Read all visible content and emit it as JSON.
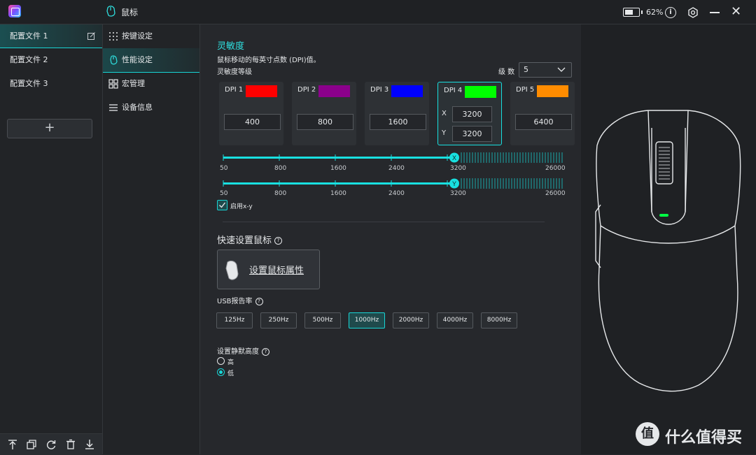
{
  "titlebar": {
    "section_title": "鼠标",
    "battery_percent": "62%"
  },
  "profiles": {
    "items": [
      {
        "label": "配置文件 1",
        "active": true
      },
      {
        "label": "配置文件 2",
        "active": false
      },
      {
        "label": "配置文件 3",
        "active": false
      }
    ],
    "add_label": "+"
  },
  "nav": {
    "items": [
      {
        "label": "按键设定",
        "icon": "grid-dots-icon",
        "active": false
      },
      {
        "label": "性能设定",
        "icon": "gauge-icon",
        "active": true
      },
      {
        "label": "宏管理",
        "icon": "macro-icon",
        "active": false
      },
      {
        "label": "设备信息",
        "icon": "list-icon",
        "active": false
      }
    ]
  },
  "sensitivity": {
    "title": "灵敏度",
    "description": "鼠标移动的每英寸点数 (DPI)值。",
    "levels_label": "灵敏度等级",
    "level_count_label": "级 数",
    "level_count_value": "5",
    "cards": [
      {
        "label": "DPI 1",
        "color": "#ff0000",
        "value": "400"
      },
      {
        "label": "DPI 2",
        "color": "#8b008b",
        "value": "800"
      },
      {
        "label": "DPI 3",
        "color": "#0000ff",
        "value": "1600"
      },
      {
        "label": "DPI 4",
        "color": "#00ff00",
        "x_label": "X",
        "x_value": "3200",
        "y_label": "Y",
        "y_value": "3200",
        "active": true
      },
      {
        "label": "DPI 5",
        "color": "#ff8c00",
        "value": "6400"
      }
    ],
    "slider_ticks": [
      "50",
      "800",
      "1600",
      "2400",
      "3200",
      "26000"
    ],
    "slider_x": {
      "handle_label": "X",
      "value": "3200"
    },
    "slider_y": {
      "handle_label": "Y",
      "value": "3200"
    },
    "enable_xy_label": "启用x-y",
    "enable_xy_checked": true
  },
  "quick_setup": {
    "title": "快速设置鼠标",
    "button_label": "设置鼠标属性"
  },
  "polling": {
    "title": "USB报告率",
    "rates": [
      "125Hz",
      "250Hz",
      "500Hz",
      "1000Hz",
      "2000Hz",
      "4000Hz",
      "8000Hz"
    ],
    "selected": "1000Hz"
  },
  "lod": {
    "title": "设置静默高度",
    "options": [
      {
        "label": "高",
        "selected": false
      },
      {
        "label": "低",
        "selected": true
      }
    ]
  },
  "watermark": {
    "text": "什么值得买"
  },
  "colors": {
    "accent": "#18d6d6",
    "background": "#26282c",
    "sidebar": "#222427"
  }
}
